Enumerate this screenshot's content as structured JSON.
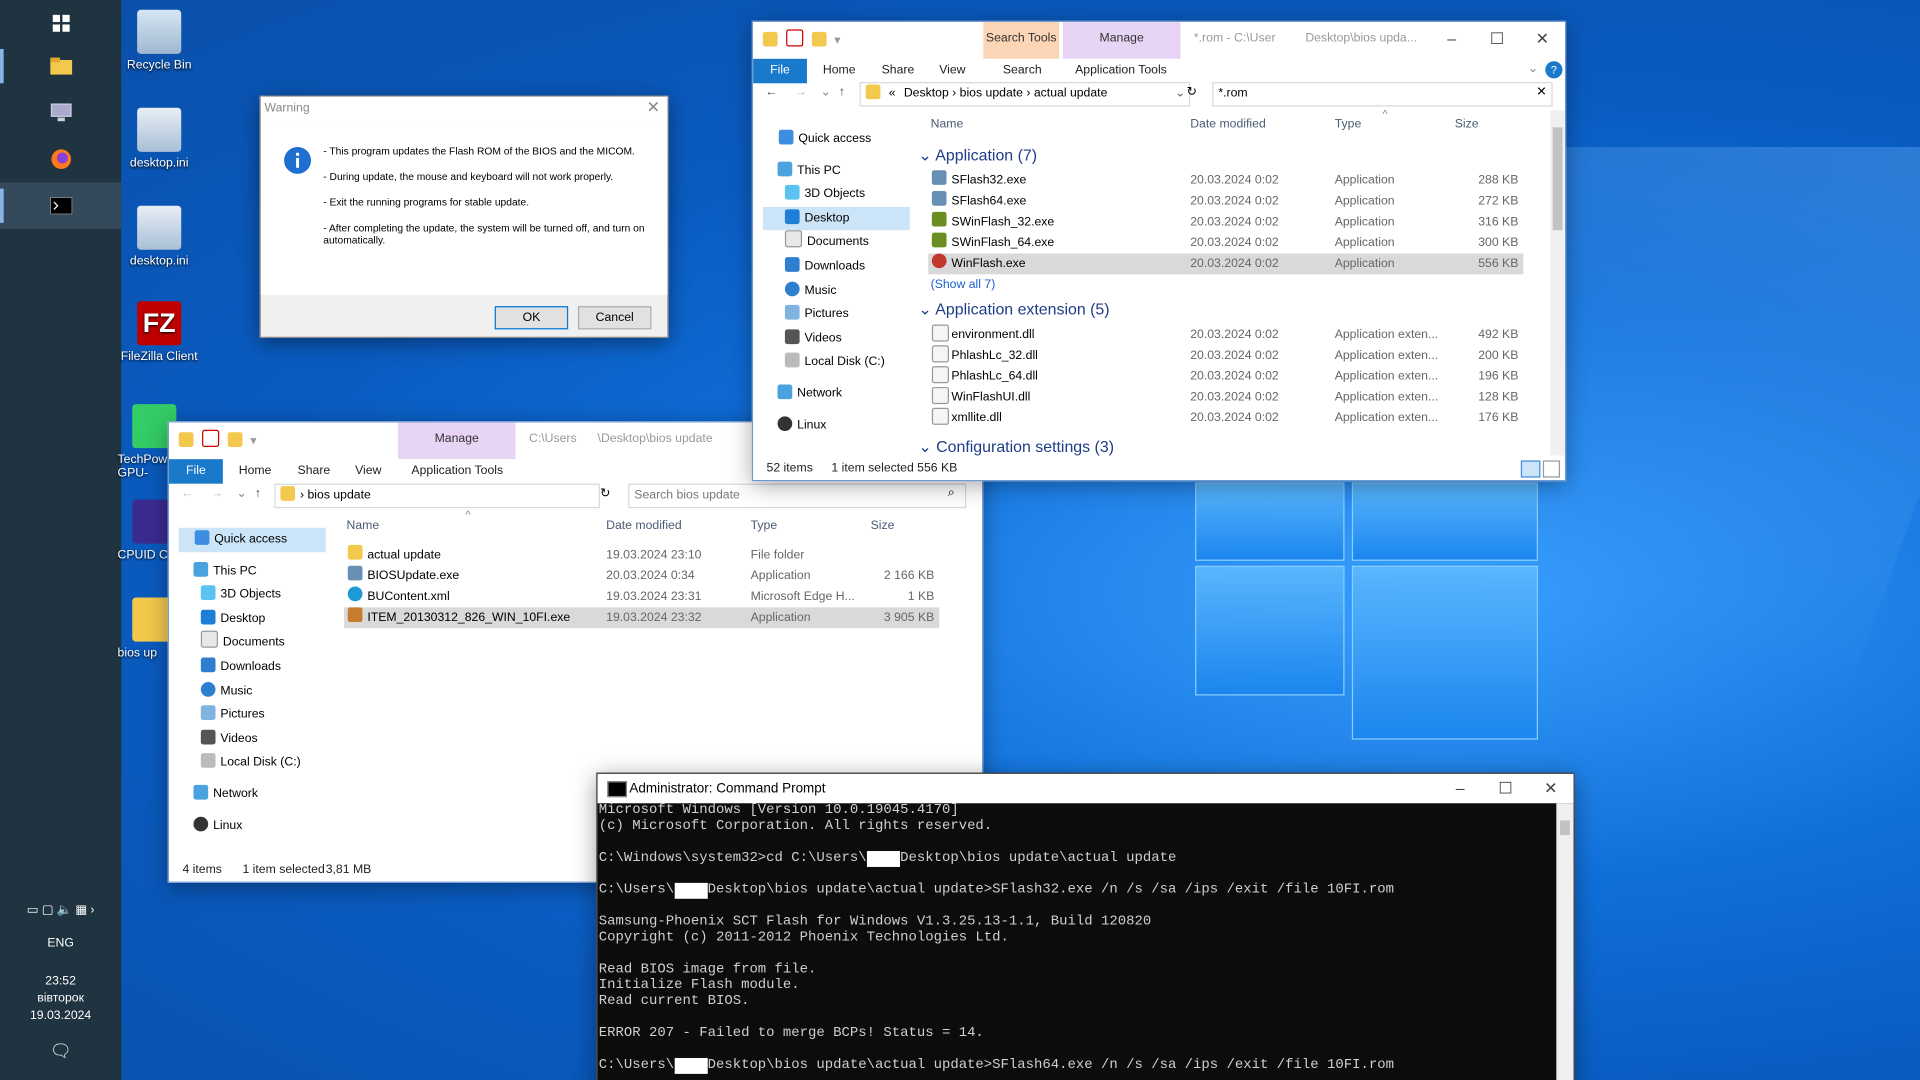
{
  "taskbar": {
    "lang": "ENG",
    "time": "23:52",
    "day": "вівторок",
    "date": "19.03.2024"
  },
  "desktop_icons": [
    {
      "label": "Recycle Bin"
    },
    {
      "label": "desktop.ini"
    },
    {
      "label": "desktop.ini"
    },
    {
      "label": "FileZilla Client"
    },
    {
      "label": "TechPow GPU-"
    },
    {
      "label": "CPUID C"
    },
    {
      "label": "bios up"
    }
  ],
  "warning_dialog": {
    "title": "Warning",
    "lines": [
      "- This program updates the Flash ROM of the BIOS and the MICOM.",
      "- During update, the mouse and keyboard will not work properly.",
      "- Exit the running programs for stable update.",
      "- After completing the update, the system will be turned off, and turn on automatically."
    ],
    "ok": "OK",
    "cancel": "Cancel"
  },
  "explorer_search": {
    "ctx_search_tools": "Search Tools",
    "ctx_manage": "Manage",
    "title": "*.rom - C:\\User",
    "title2": "Desktop\\bios upda...",
    "tabs": {
      "file": "File",
      "home": "Home",
      "share": "Share",
      "view": "View",
      "search": "Search",
      "app_tools": "Application Tools"
    },
    "breadcrumb": [
      "«",
      "Desktop",
      "bios update",
      "actual update"
    ],
    "search_value": "*.rom",
    "nav": [
      "Quick access",
      "This PC",
      "3D Objects",
      "Desktop",
      "Documents",
      "Downloads",
      "Music",
      "Pictures",
      "Videos",
      "Local Disk (C:)",
      "Network",
      "Linux"
    ],
    "columns": {
      "name": "Name",
      "date": "Date modified",
      "type": "Type",
      "size": "Size"
    },
    "group_app": "Application (7)",
    "apps": [
      {
        "name": "SFlash32.exe",
        "date": "20.03.2024 0:02",
        "type": "Application",
        "size": "288 KB"
      },
      {
        "name": "SFlash64.exe",
        "date": "20.03.2024 0:02",
        "type": "Application",
        "size": "272 KB"
      },
      {
        "name": "SWinFlash_32.exe",
        "date": "20.03.2024 0:02",
        "type": "Application",
        "size": "316 KB"
      },
      {
        "name": "SWinFlash_64.exe",
        "date": "20.03.2024 0:02",
        "type": "Application",
        "size": "300 KB"
      },
      {
        "name": "WinFlash.exe",
        "date": "20.03.2024 0:02",
        "type": "Application",
        "size": "556 KB"
      }
    ],
    "show_all": "(Show all 7)",
    "group_ext": "Application extension (5)",
    "exts": [
      {
        "name": "environment.dll",
        "date": "20.03.2024 0:02",
        "type": "Application exten...",
        "size": "492 KB"
      },
      {
        "name": "PhlashLc_32.dll",
        "date": "20.03.2024 0:02",
        "type": "Application exten...",
        "size": "200 KB"
      },
      {
        "name": "PhlashLc_64.dll",
        "date": "20.03.2024 0:02",
        "type": "Application exten...",
        "size": "196 KB"
      },
      {
        "name": "WinFlashUI.dll",
        "date": "20.03.2024 0:02",
        "type": "Application exten...",
        "size": "128 KB"
      },
      {
        "name": "xmllite.dll",
        "date": "20.03.2024 0:02",
        "type": "Application exten...",
        "size": "176 KB"
      }
    ],
    "group_cfg": "Configuration settings (3)",
    "status_items": "52 items",
    "status_sel": "1 item selected",
    "status_size": "556 KB"
  },
  "explorer_bios": {
    "ctx_manage": "Manage",
    "title": "C:\\Users",
    "title2": "\\Desktop\\bios update",
    "tabs": {
      "file": "File",
      "home": "Home",
      "share": "Share",
      "view": "View",
      "app_tools": "Application Tools"
    },
    "breadcrumb": "bios update",
    "search_placeholder": "Search bios update",
    "nav": [
      "Quick access",
      "This PC",
      "3D Objects",
      "Desktop",
      "Documents",
      "Downloads",
      "Music",
      "Pictures",
      "Videos",
      "Local Disk (C:)",
      "Network",
      "Linux"
    ],
    "columns": {
      "name": "Name",
      "date": "Date modified",
      "type": "Type",
      "size": "Size"
    },
    "files": [
      {
        "name": "actual update",
        "date": "19.03.2024 23:10",
        "type": "File folder",
        "size": ""
      },
      {
        "name": "BIOSUpdate.exe",
        "date": "20.03.2024 0:34",
        "type": "Application",
        "size": "2 166 KB"
      },
      {
        "name": "BUContent.xml",
        "date": "19.03.2024 23:31",
        "type": "Microsoft Edge H...",
        "size": "1 KB"
      },
      {
        "name": "ITEM_20130312_826_WIN_10FI.exe",
        "date": "19.03.2024 23:32",
        "type": "Application",
        "size": "3 905 KB"
      }
    ],
    "status_items": "4 items",
    "status_sel": "1 item selected",
    "status_size": "3,81 MB"
  },
  "cmd": {
    "title": "Administrator: Command Prompt",
    "lines": [
      "Microsoft Windows [Version 10.0.19045.4170]",
      "(c) Microsoft Corporation. All rights reserved.",
      "",
      "C:\\Windows\\system32>cd C:\\Users\\[REDACTED]Desktop\\bios update\\actual update",
      "",
      "C:\\Users\\[REDACTED]Desktop\\bios update\\actual update>SFlash32.exe /n /s /sa /ips /exit /file 10FI.rom",
      "",
      "Samsung-Phoenix SCT Flash for Windows V1.3.25.13-1.1, Build 120820",
      "Copyright (c) 2011-2012 Phoenix Technologies Ltd.",
      "",
      "Read BIOS image from file.",
      "Initialize Flash module.",
      "Read current BIOS.",
      "",
      "ERROR 207 - Failed to merge BCPs! Status = 14.",
      "",
      "C:\\Users\\[REDACTED]Desktop\\bios update\\actual update>SFlash64.exe /n /s /sa /ips /exit /file 10FI.rom"
    ]
  },
  "colors": {
    "accent": "#1979ca",
    "desktop": "#0a5bc0",
    "taskbar": "#1f3340"
  }
}
